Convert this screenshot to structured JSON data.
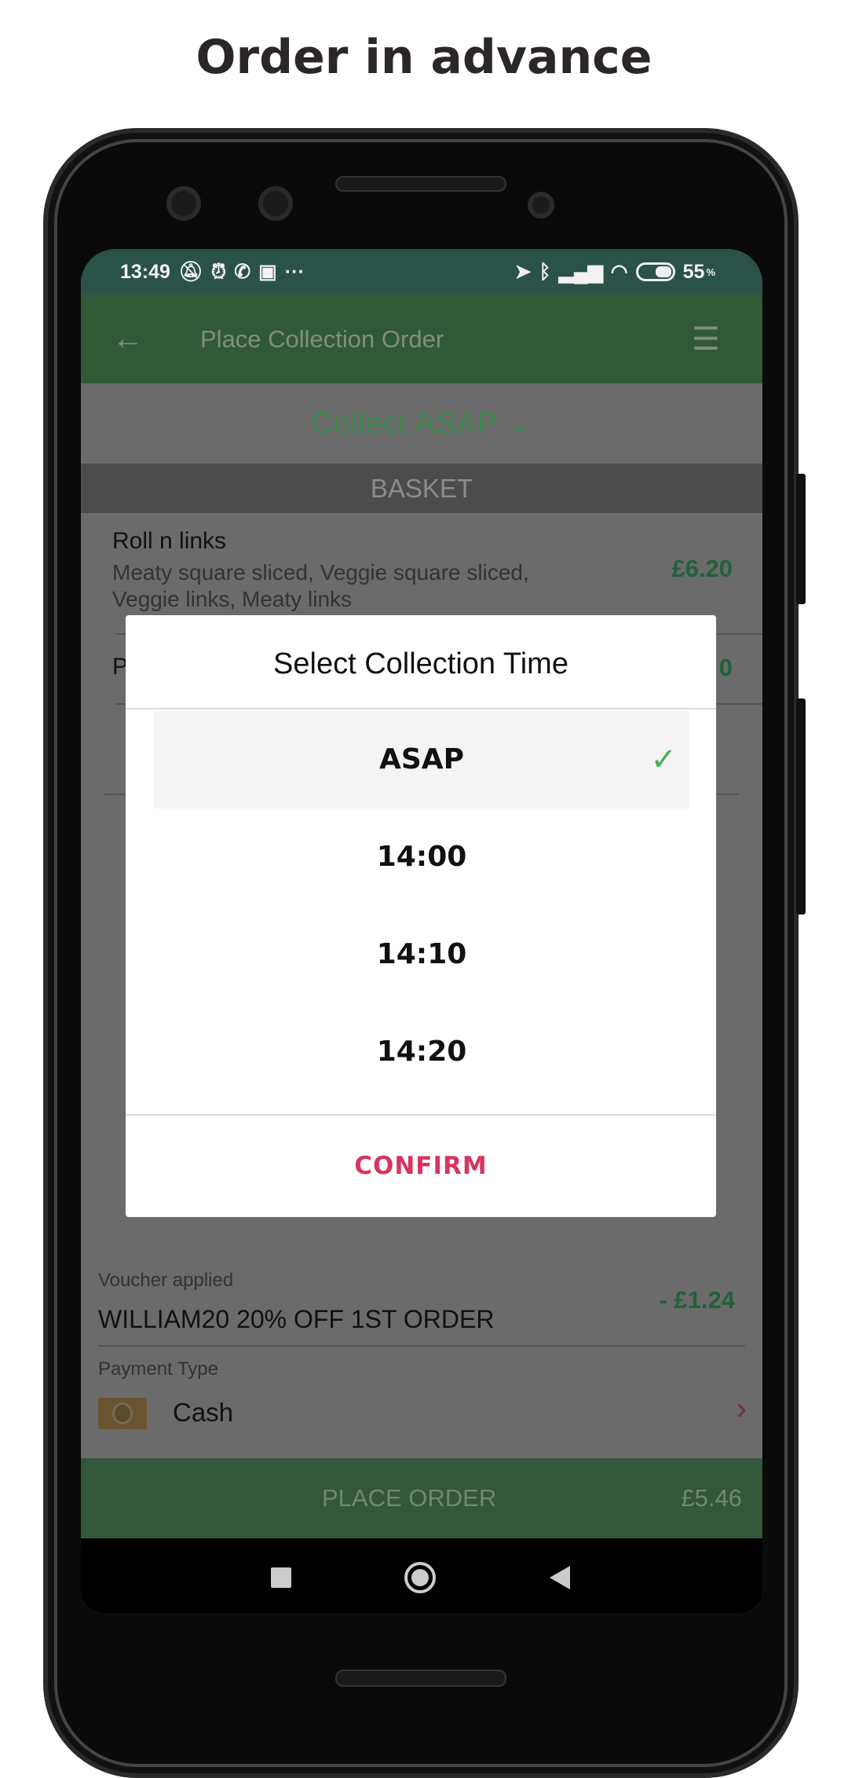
{
  "headline": "Order in advance",
  "status": {
    "time": "13:49",
    "battery": "55",
    "battery_unit": "%",
    "icons": [
      "mute-bell-icon",
      "alarm-icon",
      "whatsapp-icon",
      "calendar-icon",
      "more-icon",
      "location-icon",
      "bluetooth-icon",
      "signal-icon",
      "wifi-icon",
      "battery-icon"
    ]
  },
  "appbar": {
    "title": "Place Collection Order"
  },
  "collect": {
    "label": "Collect ASAP"
  },
  "basket": {
    "header": "BASKET",
    "items": [
      {
        "name": "Roll n links",
        "desc1": "Meaty square sliced, Veggie square sliced,",
        "desc2": "Veggie links, Meaty links",
        "price": "£6.20"
      },
      {
        "name": "P",
        "price": "0"
      }
    ]
  },
  "dialog": {
    "title": "Select Collection Time",
    "options": [
      {
        "label": "ASAP",
        "selected": true
      },
      {
        "label": "14:00"
      },
      {
        "label": "14:10"
      },
      {
        "label": "14:20"
      }
    ],
    "confirm": "CONFIRM"
  },
  "voucher": {
    "label": "Voucher applied",
    "code": "WILLIAM20 20% OFF 1ST ORDER",
    "amount": "- £1.24"
  },
  "payment": {
    "label": "Payment Type",
    "method": "Cash"
  },
  "place_order": {
    "label": "PLACE ORDER",
    "total": "£5.46"
  },
  "colors": {
    "brand_green": "#4caf50",
    "confirm": "#d8345f",
    "status_bar": "#2b5249"
  }
}
